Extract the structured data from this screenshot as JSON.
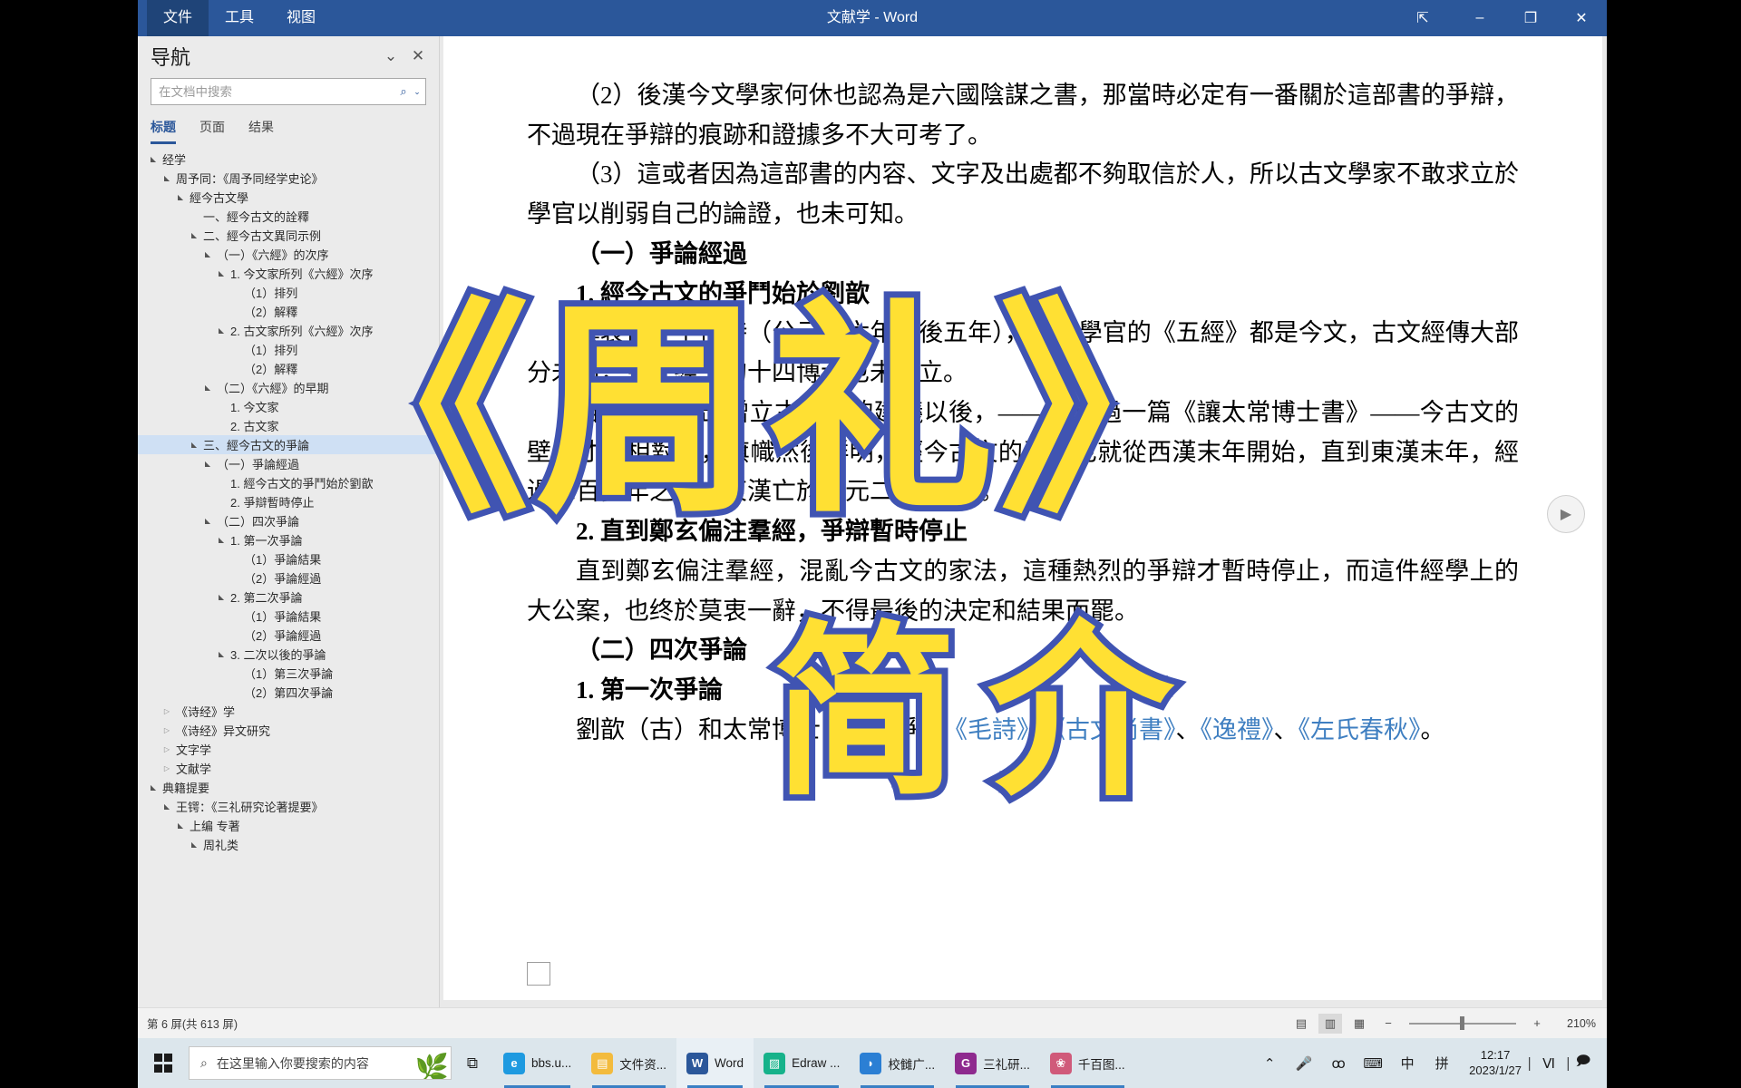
{
  "window": {
    "title": "文献学 - Word",
    "menu": [
      {
        "label": "文件",
        "active": true
      },
      {
        "label": "工具",
        "active": false
      },
      {
        "label": "视图",
        "active": false
      }
    ],
    "buttons": {
      "ribbon_pin": "⇱",
      "minimize": "–",
      "maximize": "❐",
      "close": "✕"
    }
  },
  "navigation": {
    "title": "导航",
    "collapse_icon": "⌄",
    "close_icon": "✕",
    "search": {
      "placeholder": "在文档中搜索",
      "value": "",
      "search_icon": "⌕",
      "chevron_icon": "⌄"
    },
    "tabs": [
      {
        "label": "标题",
        "active": true
      },
      {
        "label": "页面",
        "active": false
      },
      {
        "label": "结果",
        "active": false
      }
    ],
    "tree": [
      {
        "label": "经学",
        "indent": 0,
        "twisty": "open",
        "selected": false
      },
      {
        "label": "周予同：《周予同经学史论》",
        "indent": 1,
        "twisty": "open",
        "selected": false
      },
      {
        "label": "經今古文學",
        "indent": 2,
        "twisty": "open",
        "selected": false
      },
      {
        "label": "一、經今古文的詮釋",
        "indent": 3,
        "twisty": "none",
        "selected": false
      },
      {
        "label": "二、經今古文異同示例",
        "indent": 3,
        "twisty": "open",
        "selected": false
      },
      {
        "label": "（一）《六經》的次序",
        "indent": 4,
        "twisty": "open",
        "selected": false
      },
      {
        "label": "1. 今文家所列《六經》次序",
        "indent": 5,
        "twisty": "open",
        "selected": false
      },
      {
        "label": "（1）排列",
        "indent": 6,
        "twisty": "none",
        "selected": false
      },
      {
        "label": "（2）解釋",
        "indent": 6,
        "twisty": "none",
        "selected": false
      },
      {
        "label": "2. 古文家所列《六經》次序",
        "indent": 5,
        "twisty": "open",
        "selected": false
      },
      {
        "label": "（1）排列",
        "indent": 6,
        "twisty": "none",
        "selected": false
      },
      {
        "label": "（2）解釋",
        "indent": 6,
        "twisty": "none",
        "selected": false
      },
      {
        "label": "（二）《六經》的早期",
        "indent": 4,
        "twisty": "open",
        "selected": false
      },
      {
        "label": "1. 今文家",
        "indent": 5,
        "twisty": "none",
        "selected": false
      },
      {
        "label": "2. 古文家",
        "indent": 5,
        "twisty": "none",
        "selected": false
      },
      {
        "label": "三、經今古文的爭論",
        "indent": 3,
        "twisty": "open",
        "selected": true
      },
      {
        "label": "（一）爭論經過",
        "indent": 4,
        "twisty": "open",
        "selected": false
      },
      {
        "label": "1. 經今古文的爭鬥始於劉歆",
        "indent": 5,
        "twisty": "none",
        "selected": false
      },
      {
        "label": "2. 爭辯暫時停止",
        "indent": 5,
        "twisty": "none",
        "selected": false
      },
      {
        "label": "（二）四次爭論",
        "indent": 4,
        "twisty": "open",
        "selected": false
      },
      {
        "label": "1. 第一次爭論",
        "indent": 5,
        "twisty": "open",
        "selected": false
      },
      {
        "label": "（1）爭論結果",
        "indent": 6,
        "twisty": "none",
        "selected": false
      },
      {
        "label": "（2）爭論經過",
        "indent": 6,
        "twisty": "none",
        "selected": false
      },
      {
        "label": "2. 第二次爭論",
        "indent": 5,
        "twisty": "open",
        "selected": false
      },
      {
        "label": "（1）爭論結果",
        "indent": 6,
        "twisty": "none",
        "selected": false
      },
      {
        "label": "（2）爭論經過",
        "indent": 6,
        "twisty": "none",
        "selected": false
      },
      {
        "label": "3. 二次以後的爭論",
        "indent": 5,
        "twisty": "open",
        "selected": false
      },
      {
        "label": "（1）第三次爭論",
        "indent": 6,
        "twisty": "none",
        "selected": false
      },
      {
        "label": "（2）第四次爭論",
        "indent": 6,
        "twisty": "none",
        "selected": false
      },
      {
        "label": "《诗经》学",
        "indent": 1,
        "twisty": "closed",
        "selected": false
      },
      {
        "label": "《诗经》异文研究",
        "indent": 1,
        "twisty": "closed",
        "selected": false
      },
      {
        "label": "文字学",
        "indent": 1,
        "twisty": "closed",
        "selected": false
      },
      {
        "label": "文献学",
        "indent": 1,
        "twisty": "closed",
        "selected": false
      },
      {
        "label": "典籍提要",
        "indent": 0,
        "twisty": "open",
        "selected": false
      },
      {
        "label": "王锷：《三礼研究论著提要》",
        "indent": 1,
        "twisty": "open",
        "selected": false
      },
      {
        "label": "上编 专著",
        "indent": 2,
        "twisty": "open",
        "selected": false
      },
      {
        "label": "周礼类",
        "indent": 3,
        "twisty": "open",
        "selected": false
      }
    ]
  },
  "document": {
    "paragraphs": [
      {
        "text": "（2）後漢今文學家何休也認為是六國陰謀之書，那當時必定有一番關於這部書的爭辯，不過現在爭辯的痕跡和證據多不大可考了。",
        "bold": false,
        "indent": true
      },
      {
        "text": "（3）這或者因為這部書的内容、文字及出處都不夠取信於人，所以古文學家不敢求立於學官以削弱自己的論證，也未可知。",
        "bold": false,
        "indent": true
      },
      {
        "text": "（一）爭論經過",
        "bold": true,
        "indent": true
      },
      {
        "text": "1. 經今古文的爭鬥始於劉歆",
        "bold": true,
        "indent": true
      },
      {
        "text": "漢哀帝、平帝時（公元前六年至後五年），立在學官的《五經》都是今文，古文經傳大部分未出，今文經學的十四博士也未成立。",
        "bold": false,
        "indent": true
      },
      {
        "text": "自從劉歆提出增立古文經的建議以後，——他寫過一篇《讓太常博士書》——今古文的壁壘才互相對峙，旗幟然後鮮明，經今古文的爭論也就從西漢末年開始，直到東漢末年，經過二百多年之久（東漢亡於公元二一九年）。",
        "bold": false,
        "indent": true
      },
      {
        "text": "2. 直到鄭玄偏注羣經，爭辯暫時停止",
        "bold": true,
        "indent": true
      },
      {
        "text": "直到鄭玄偏注羣經，混亂今古文的家法，這種熱烈的爭辯才暫時停止，而這件經學上的大公案，也终於莫衷一辭，不得最後的決定和結果而罷。",
        "bold": false,
        "indent": true
      },
      {
        "text": "（二）四次爭論",
        "bold": true,
        "indent": true
      },
      {
        "text": "1. 第一次爭論",
        "bold": true,
        "indent": true
      },
      {
        "text": "劉歆（古）和太常博士（今）爭立《毛詩》、《古文尚書》、《逸禮》、《左氏春秋》。",
        "bold": false,
        "indent": true,
        "links": [
          "《毛詩》",
          "《古文尚書》",
          "《逸禮》",
          "《左氏春秋》"
        ]
      }
    ],
    "play_icon": "▶"
  },
  "watermark": {
    "line1": "《周礼》",
    "line2": "简介",
    "fill_color": "#ffe033",
    "stroke_color": "#4054b2"
  },
  "status_bar": {
    "page_info": "第 6 屏(共 613 屏)",
    "view_buttons": [
      {
        "name": "read-mode",
        "icon": "▤",
        "active": false
      },
      {
        "name": "print-layout",
        "icon": "▥",
        "active": true
      },
      {
        "name": "web-layout",
        "icon": "▦",
        "active": false
      }
    ],
    "zoom_out": "−",
    "zoom_in": "+",
    "zoom_level": "210%"
  },
  "taskbar": {
    "search_placeholder": "在这里输入你要搜索的内容",
    "search_icon": "⌕",
    "plant_icon": "🌿",
    "task_view_icon": "⧉",
    "apps": [
      {
        "label": "bbs.u...",
        "glyph": "e",
        "color": "#1e9ae0",
        "active": false
      },
      {
        "label": "文件资...",
        "glyph": "▤",
        "color": "#f3bb3d",
        "active": false
      },
      {
        "label": "Word",
        "glyph": "W",
        "color": "#2b579a",
        "active": true
      },
      {
        "label": "Edraw ...",
        "glyph": "▨",
        "color": "#16b28a",
        "active": false
      },
      {
        "label": "校雠广...",
        "glyph": "◗",
        "color": "#2b7fd4",
        "active": false
      },
      {
        "label": "三礼研...",
        "glyph": "G",
        "color": "#8e2a8e",
        "active": false
      },
      {
        "label": "千百图...",
        "glyph": "❀",
        "color": "#d05a7a",
        "active": false
      }
    ],
    "tray": [
      {
        "name": "show-hidden-icons",
        "icon": "⌃"
      },
      {
        "name": "microphone-icon",
        "icon": "🎤"
      },
      {
        "name": "bluetooth-icon",
        "icon": "ꝏ"
      },
      {
        "name": "keyboard-icon",
        "icon": "⌨"
      },
      {
        "name": "ime-chinese-icon",
        "icon": "中"
      },
      {
        "name": "ime-pinyin-icon",
        "icon": "拼"
      }
    ],
    "clock": {
      "time": "12:17",
      "date": "2023/1/27"
    },
    "tray_right": [
      {
        "name": "monitor-icon",
        "icon": "⎸Ⅵ⎹"
      },
      {
        "name": "notifications-icon",
        "icon": "🗩"
      }
    ]
  }
}
